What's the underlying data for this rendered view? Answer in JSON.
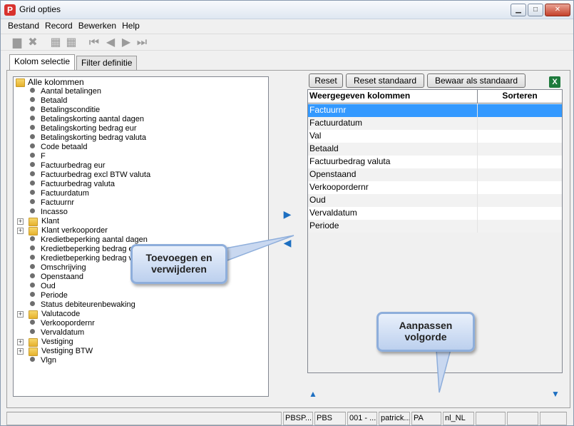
{
  "window": {
    "title": "Grid opties",
    "app_icon_letter": "P",
    "buttons": {
      "minimize": "▁",
      "maximize": "□",
      "close": "✕"
    }
  },
  "menu": [
    "Bestand",
    "Record",
    "Bewerken",
    "Help"
  ],
  "toolbar": {
    "icons": [
      "new-document-icon",
      "delete-icon",
      "save-icon",
      "save-all-icon",
      "first-record-icon",
      "previous-record-icon",
      "next-record-icon",
      "last-record-icon"
    ]
  },
  "tabs": [
    {
      "label": "Kolom selectie",
      "active": true
    },
    {
      "label": "Filter definitie",
      "active": false
    }
  ],
  "tree": {
    "root": "Alle kolommen",
    "items": [
      {
        "label": "Aantal betalingen",
        "type": "leaf"
      },
      {
        "label": "Betaald",
        "type": "leaf"
      },
      {
        "label": "Betalingsconditie",
        "type": "leaf"
      },
      {
        "label": "Betalingskorting aantal dagen",
        "type": "leaf"
      },
      {
        "label": "Betalingskorting bedrag eur",
        "type": "leaf"
      },
      {
        "label": "Betalingskorting bedrag valuta",
        "type": "leaf"
      },
      {
        "label": "Code betaald",
        "type": "leaf"
      },
      {
        "label": "F",
        "type": "leaf"
      },
      {
        "label": "Factuurbedrag eur",
        "type": "leaf"
      },
      {
        "label": "Factuurbedrag excl BTW valuta",
        "type": "leaf"
      },
      {
        "label": "Factuurbedrag valuta",
        "type": "leaf"
      },
      {
        "label": "Factuurdatum",
        "type": "leaf"
      },
      {
        "label": "Factuurnr",
        "type": "leaf"
      },
      {
        "label": "Incasso",
        "type": "leaf"
      },
      {
        "label": "Klant",
        "type": "folder"
      },
      {
        "label": "Klant verkooporder",
        "type": "folder"
      },
      {
        "label": "Kredietbeperking aantal dagen",
        "type": "leaf"
      },
      {
        "label": "Kredietbeperking bedrag eur",
        "type": "leaf"
      },
      {
        "label": "Kredietbeperking bedrag valuta",
        "type": "leaf"
      },
      {
        "label": "Omschrijving",
        "type": "leaf"
      },
      {
        "label": "Openstaand",
        "type": "leaf"
      },
      {
        "label": "Oud",
        "type": "leaf"
      },
      {
        "label": "Periode",
        "type": "leaf"
      },
      {
        "label": "Status debiteurenbewaking",
        "type": "leaf"
      },
      {
        "label": "Valutacode",
        "type": "folder"
      },
      {
        "label": "Verkoopordernr",
        "type": "leaf"
      },
      {
        "label": "Vervaldatum",
        "type": "leaf"
      },
      {
        "label": "Vestiging",
        "type": "folder"
      },
      {
        "label": "Vestiging BTW",
        "type": "folder"
      },
      {
        "label": "Vlgn",
        "type": "leaf"
      }
    ]
  },
  "buttons": {
    "reset": "Reset",
    "reset_default": "Reset standaard",
    "save_default": "Bewaar als standaard"
  },
  "grid": {
    "headers": [
      "Weergegeven kolommen",
      "Sorteren"
    ],
    "rows": [
      "Factuurnr",
      "Factuurdatum",
      "Val",
      "Betaald",
      "Factuurbedrag valuta",
      "Openstaand",
      "Verkoopordernr",
      "Oud",
      "Vervaldatum",
      "Periode"
    ],
    "selected_index": 0
  },
  "callouts": {
    "add_remove": "Toevoegen en verwijderen",
    "reorder": "Aanpassen volgorde"
  },
  "statusbar": [
    "",
    "PBSP...",
    "PBS",
    "001 - ...",
    "patrick...",
    "PA",
    "nl_NL",
    "",
    "",
    ""
  ],
  "colors": {
    "selection": "#3399ff",
    "arrow": "#1d6fc1",
    "callout_border": "#8eaedb"
  }
}
